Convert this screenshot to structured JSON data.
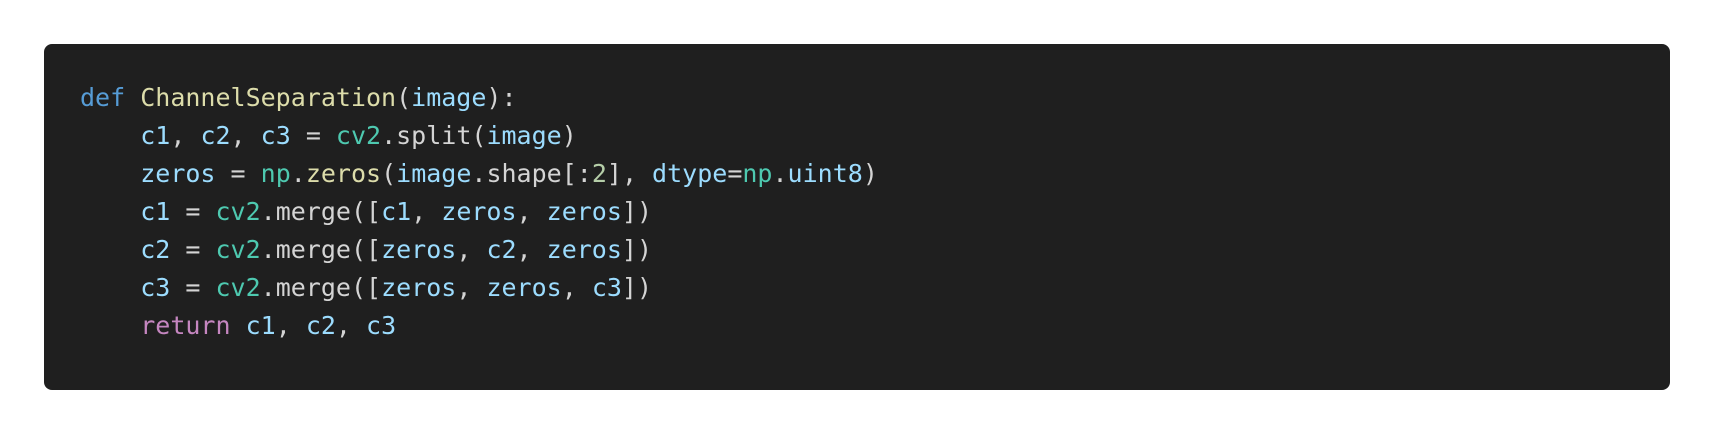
{
  "code": {
    "line1": {
      "kw": "def",
      "fn": "ChannelSeparation",
      "open": "(",
      "param": "image",
      "close": "):"
    },
    "line2": {
      "indent": "    ",
      "a": "c1",
      "s1": ", ",
      "b": "c2",
      "s2": ", ",
      "c": "c3",
      "eq": " = ",
      "mod": "cv2",
      "call": ".split(",
      "arg": "image",
      "end": ")"
    },
    "line3": {
      "indent": "    ",
      "lhs": "zeros",
      "eq": " = ",
      "mod": "np",
      "dot1": ".",
      "fn": "zeros",
      "open": "(",
      "arg": "image",
      "attr": ".shape[:",
      "num": "2",
      "sep": "], ",
      "kwarg": "dtype",
      "assign": "=",
      "mod2": "np",
      "dot2": ".",
      "dtype": "uint8",
      "end": ")"
    },
    "line4": {
      "indent": "    ",
      "lhs": "c1",
      "eq": " = ",
      "mod": "cv2",
      "call": ".merge([",
      "a": "c1",
      "s1": ", ",
      "b": "zeros",
      "s2": ", ",
      "c": "zeros",
      "end": "])"
    },
    "line5": {
      "indent": "    ",
      "lhs": "c2",
      "eq": " = ",
      "mod": "cv2",
      "call": ".merge([",
      "a": "zeros",
      "s1": ", ",
      "b": "c2",
      "s2": ", ",
      "c": "zeros",
      "end": "])"
    },
    "line6": {
      "indent": "    ",
      "lhs": "c3",
      "eq": " = ",
      "mod": "cv2",
      "call": ".merge([",
      "a": "zeros",
      "s1": ", ",
      "b": "zeros",
      "s2": ", ",
      "c": "c3",
      "end": "])"
    },
    "line7": {
      "indent": "    ",
      "kw": "return",
      "sp": " ",
      "a": "c1",
      "s1": ", ",
      "b": "c2",
      "s2": ", ",
      "c": "c3"
    }
  },
  "colors": {
    "background": "#1f1f1f",
    "keyword_def": "#569cd6",
    "keyword_return": "#c586c0",
    "function": "#dcdcaa",
    "variable": "#9cdcfe",
    "module": "#4ec9b0",
    "number": "#b5cea8",
    "text": "#d4d4d4"
  }
}
